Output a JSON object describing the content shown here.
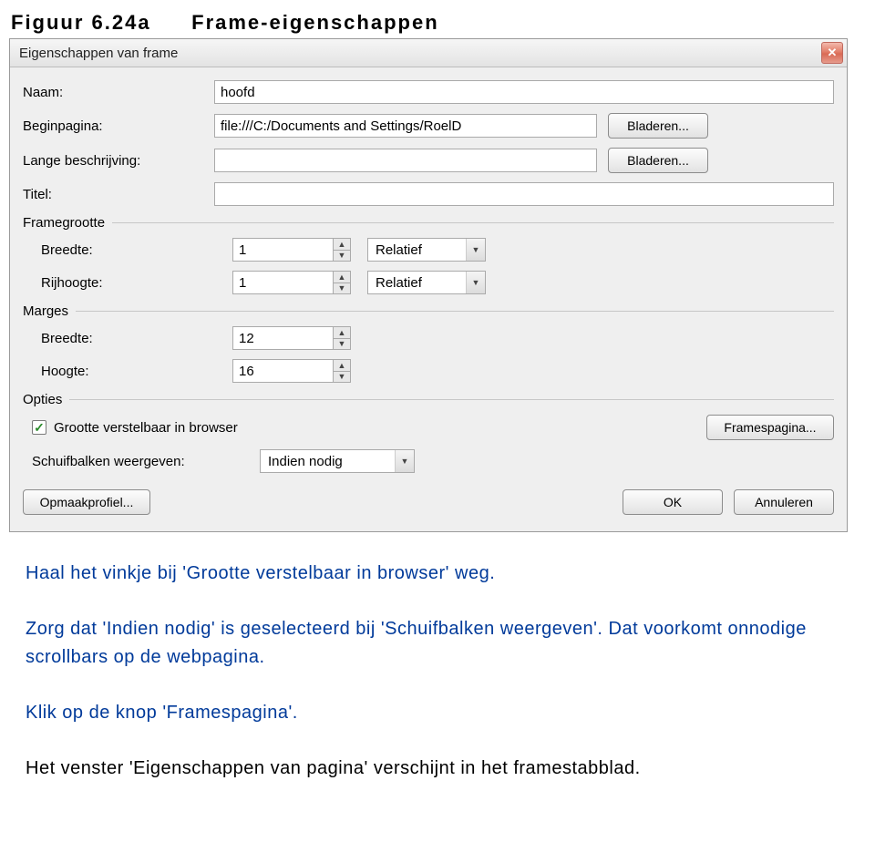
{
  "figure": {
    "number": "Figuur 6.24a",
    "title": "Frame-eigenschappen"
  },
  "dialog": {
    "title": "Eigenschappen van frame",
    "fields": {
      "name_label": "Naam:",
      "name_value": "hoofd",
      "start_label": "Beginpagina:",
      "start_value": "file:///C:/Documents and Settings/RoelD",
      "longdesc_label": "Lange beschrijving:",
      "longdesc_value": "",
      "title_label": "Titel:",
      "title_value": ""
    },
    "browse": "Bladeren...",
    "groups": {
      "size": "Framegrootte",
      "margins": "Marges",
      "options": "Opties"
    },
    "size": {
      "width_label": "Breedte:",
      "width_value": "1",
      "width_unit": "Relatief",
      "rowheight_label": "Rijhoogte:",
      "rowheight_value": "1",
      "rowheight_unit": "Relatief"
    },
    "margins": {
      "width_label": "Breedte:",
      "width_value": "12",
      "height_label": "Hoogte:",
      "height_value": "16"
    },
    "options": {
      "resizable_label": "Grootte verstelbaar in browser",
      "resizable_checked": true,
      "framespage_btn": "Framespagina...",
      "scrollbars_label": "Schuifbalken weergeven:",
      "scrollbars_value": "Indien nodig"
    },
    "buttons": {
      "style": "Opmaakprofiel...",
      "ok": "OK",
      "cancel": "Annuleren"
    }
  },
  "instructions": {
    "p1": "Haal het vinkje bij 'Grootte verstelbaar in browser' weg.",
    "p2": "Zorg dat 'Indien nodig' is geselecteerd bij 'Schuifbalken weergeven'. Dat voorkomt onnodige scrollbars op de webpagina.",
    "p3": "Klik op de knop 'Framespagina'.",
    "p4": "Het venster 'Eigenschappen van pagina' verschijnt in het framestabblad."
  }
}
